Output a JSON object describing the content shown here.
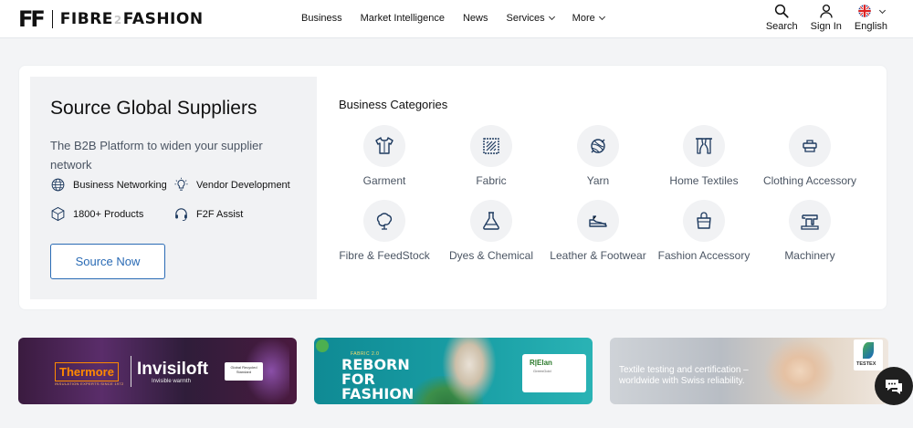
{
  "header": {
    "logo_mark": "FF",
    "logo_left": "FIBRE",
    "logo_mid": "2",
    "logo_right": "FASHION",
    "nav": [
      {
        "label": "Business",
        "has_dropdown": false
      },
      {
        "label": "Market Intelligence",
        "has_dropdown": false
      },
      {
        "label": "News",
        "has_dropdown": false
      },
      {
        "label": "Services",
        "has_dropdown": true
      },
      {
        "label": "More",
        "has_dropdown": true
      }
    ],
    "tools": {
      "search": "Search",
      "signin": "Sign In",
      "language": "English"
    }
  },
  "source": {
    "title": "Source Global Suppliers",
    "subtitle": "The B2B Platform to widen your supplier network",
    "features": [
      {
        "label": "Business Networking",
        "icon": "globe-icon"
      },
      {
        "label": "Vendor Development",
        "icon": "bulb-icon"
      },
      {
        "label": "1800+ Products",
        "icon": "box-icon"
      },
      {
        "label": "F2F Assist",
        "icon": "headset-icon"
      }
    ],
    "button": "Source Now"
  },
  "categories": {
    "title": "Business Categories",
    "items": [
      {
        "label": "Garment",
        "icon": "garment-icon"
      },
      {
        "label": "Fabric",
        "icon": "fabric-icon"
      },
      {
        "label": "Yarn",
        "icon": "yarn-icon"
      },
      {
        "label": "Home Textiles",
        "icon": "curtain-icon"
      },
      {
        "label": "Clothing Accessory",
        "icon": "accessory-icon"
      },
      {
        "label": "Fibre & FeedStock",
        "icon": "fibre-icon"
      },
      {
        "label": "Dyes & Chemical",
        "icon": "flask-icon"
      },
      {
        "label": "Leather & Footwear",
        "icon": "shoe-icon"
      },
      {
        "label": "Fashion Accessory",
        "icon": "bag-icon"
      },
      {
        "label": "Machinery",
        "icon": "sewing-machine-icon"
      }
    ]
  },
  "banners": {
    "thermore": {
      "brand": "Thermore",
      "tagline": "INSULATION EXPERTS SINCE 1972",
      "product": "Invisiloft",
      "product_sub": "Invisible warmth",
      "badge": "Global Recycled Standard"
    },
    "reliance": {
      "kicker": "FABRIC 2.0",
      "headline": "REBORN FOR FASHION",
      "brand": "R|Elan",
      "brand_sub": "GreenGold"
    },
    "testex": {
      "text": "Textile testing and certification – worldwide with Swiss reliability.",
      "brand": "TESTEX"
    }
  },
  "colors": {
    "accent": "#2a6bb5",
    "icon": "#1e3a5f"
  }
}
